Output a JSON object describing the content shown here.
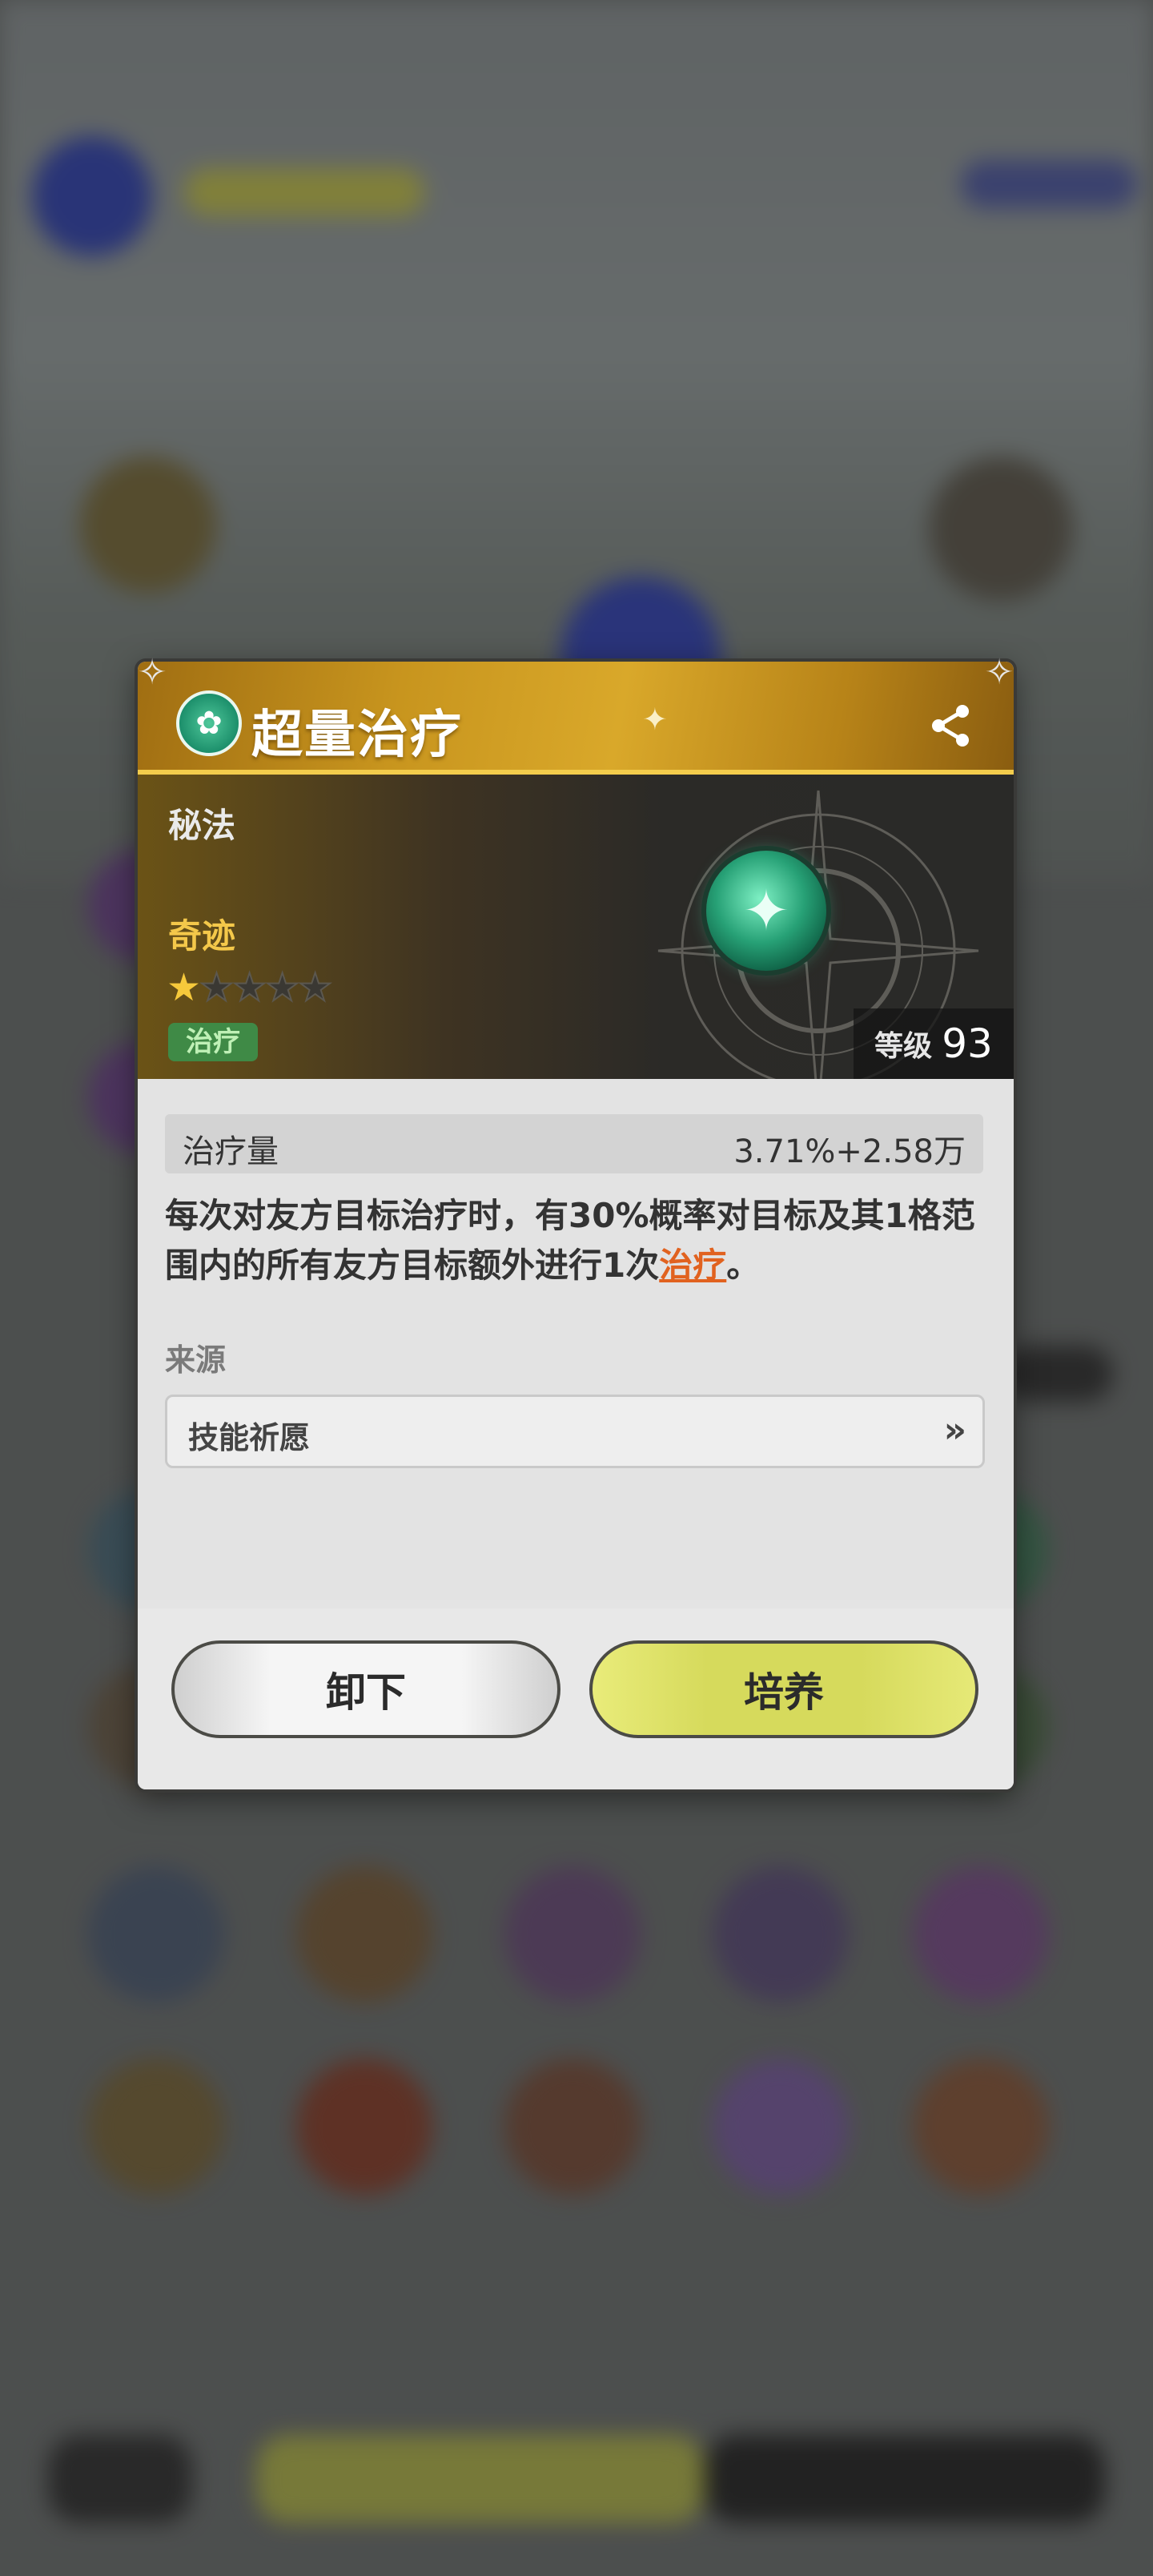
{
  "dialog": {
    "title": "超量治疗",
    "category": "秘法",
    "rarity": "奇迹",
    "stars": {
      "filled": 1,
      "total": 5
    },
    "tag": "治疗",
    "level_label": "等级",
    "level_value": "93",
    "stat": {
      "label": "治疗量",
      "value": "3.71%+2.58万"
    },
    "description": {
      "text": "每次对友方目标治疗时，有30%概率对目标及其1格范围内的所有友方目标额外进行1次",
      "link": "治疗",
      "suffix": "。"
    },
    "source_label": "来源",
    "source_value": "技能祈愿",
    "buttons": {
      "unequip": "卸下",
      "train": "培养"
    }
  },
  "icons": {
    "skill": "heal-skill-icon",
    "share": "share-icon",
    "orb": "skill-orb-icon",
    "source_arrow": "double-chevron-right-icon"
  },
  "colors": {
    "header_gold": "#d9a82a",
    "rarity_text": "#f4c84a",
    "star_filled": "#f6c93b",
    "tag_bg": "#3f8a46",
    "link": "#e1621f",
    "train_button": "#d6da5c"
  }
}
